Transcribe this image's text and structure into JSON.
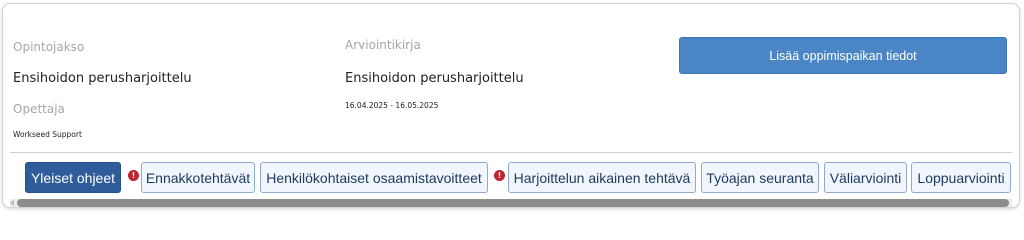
{
  "course": {
    "label": "Opintojakso",
    "value": "Ensihoidon perusharjoittelu"
  },
  "assessment": {
    "label": "Arviointikirja",
    "value": "Ensihoidon perusharjoittelu",
    "dates": "16.04.2025 - 16.05.2025"
  },
  "teacher": {
    "label": "Opettaja",
    "value": "Workseed Support"
  },
  "actions": {
    "add_workplace_label": "Lisää oppimispaikan tiedot"
  },
  "tabs": [
    {
      "label": "Yleiset ohjeet",
      "active": true
    },
    {
      "label": "Ennakkotehtävät",
      "warning": true
    },
    {
      "label": "Henkilökohtaiset osaamistavoitteet"
    },
    {
      "label": "Harjoittelun aikainen tehtävä",
      "warning": true
    },
    {
      "label": "Työajan seuranta"
    },
    {
      "label": "Väliarviointi"
    },
    {
      "label": "Loppuarviointi"
    }
  ],
  "warning_icon": "exclamation-circle-icon",
  "colors": {
    "primary_button": "#4a86c5",
    "active_tab": "#2f5c9a",
    "tab_border": "#8eaad1",
    "warning": "#c0222e"
  }
}
